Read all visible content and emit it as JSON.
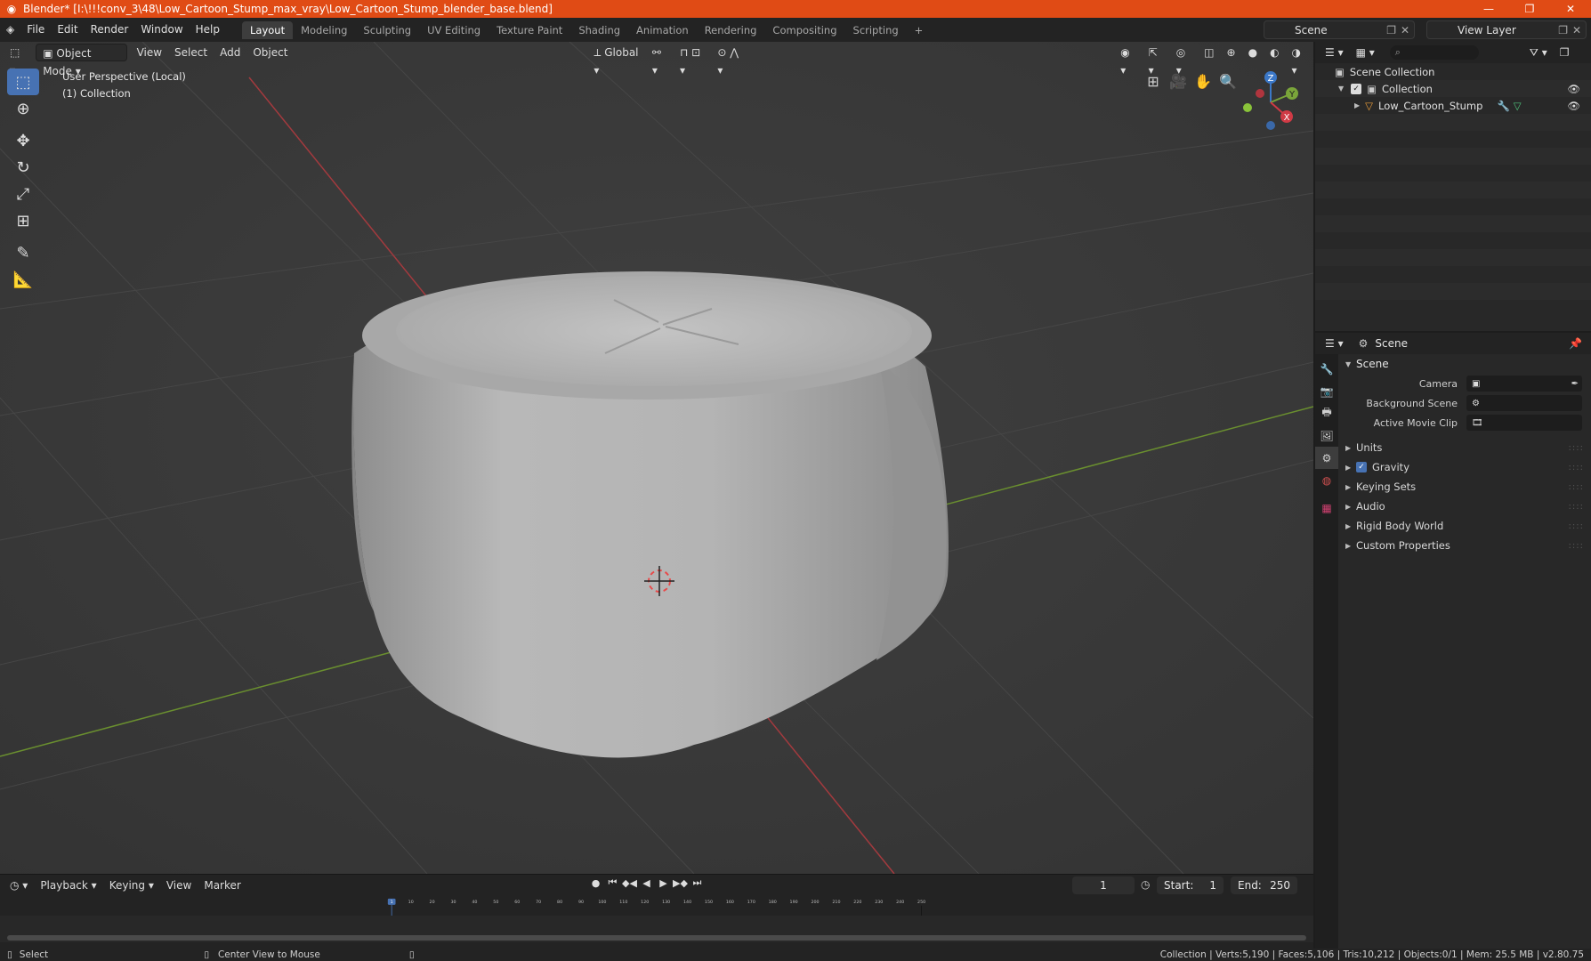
{
  "window": {
    "title": "Blender* [I:\\!!!conv_3\\48\\Low_Cartoon_Stump_max_vray\\Low_Cartoon_Stump_blender_base.blend]",
    "minimize": "—",
    "restore": "❐",
    "close": "✕"
  },
  "menu": [
    "File",
    "Edit",
    "Render",
    "Window",
    "Help"
  ],
  "workspaces": [
    "Layout",
    "Modeling",
    "Sculpting",
    "UV Editing",
    "Texture Paint",
    "Shading",
    "Animation",
    "Rendering",
    "Compositing",
    "Scripting"
  ],
  "workspace_add": "+",
  "scene_selector": "Scene",
  "view_layer_selector": "View Layer",
  "viewport": {
    "mode": "Object Mode",
    "menus": [
      "View",
      "Select",
      "Add",
      "Object"
    ],
    "transform_orientation": "Global",
    "info_line1": "User Perspective (Local)",
    "info_line2": "(1) Collection",
    "gizmo": {
      "x": "X",
      "y": "Y",
      "z": "Z"
    }
  },
  "outliner": {
    "root": "Scene Collection",
    "collection": "Collection",
    "object": "Low_Cartoon_Stump"
  },
  "properties": {
    "header": "Scene",
    "panel": "Scene",
    "camera_label": "Camera",
    "background_scene_label": "Background Scene",
    "active_movie_clip_label": "Active Movie Clip",
    "subpanels": [
      "Units",
      "Gravity",
      "Keying Sets",
      "Audio",
      "Rigid Body World",
      "Custom Properties"
    ],
    "gravity_checked": true
  },
  "timeline": {
    "menus": [
      "Playback",
      "Keying",
      "View",
      "Marker"
    ],
    "current_frame": "1",
    "start_label": "Start:",
    "start": "1",
    "end_label": "End:",
    "end": "250",
    "ruler": [
      "1",
      "10",
      "20",
      "30",
      "40",
      "50",
      "60",
      "70",
      "80",
      "90",
      "100",
      "110",
      "120",
      "130",
      "140",
      "150",
      "160",
      "170",
      "180",
      "190",
      "200",
      "210",
      "220",
      "230",
      "240",
      "250"
    ]
  },
  "statusbar": {
    "select": "Select",
    "center_view": "Center View to Mouse",
    "stats": "Collection | Verts:5,190 | Faces:5,106 | Tris:10,212 | Objects:0/1 | Mem: 25.5 MB | v2.80.75"
  },
  "colors": {
    "title_bar": "#e04b15",
    "active_blue": "#4772b3",
    "x_axis": "#c8323a",
    "y_axis": "#7aa53a",
    "viewport_bg": "#3a3a3a"
  }
}
